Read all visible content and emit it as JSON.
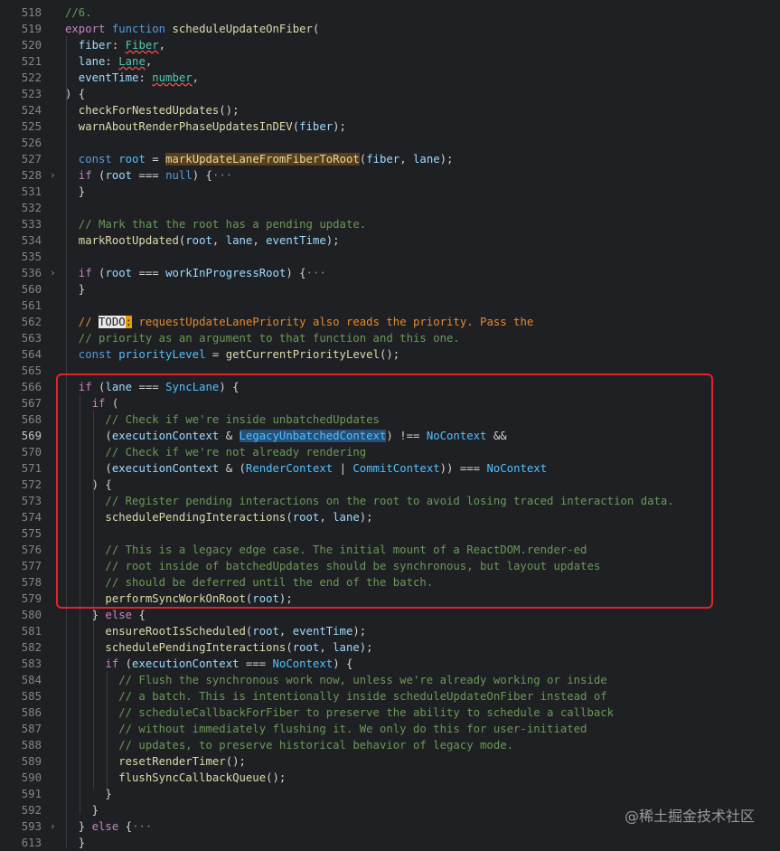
{
  "editor": {
    "lines": [
      {
        "n": "518",
        "segs": [
          [
            "cm",
            "//6."
          ]
        ]
      },
      {
        "n": "519",
        "segs": [
          [
            "ctl",
            "export "
          ],
          [
            "kw",
            "function "
          ],
          [
            "fn",
            "scheduleUpdateOnFiber"
          ],
          [
            "p",
            "("
          ]
        ]
      },
      {
        "n": "520",
        "segs": [
          [
            "var",
            "  fiber"
          ],
          [
            "p",
            ": "
          ],
          [
            "type squig",
            "Fiber"
          ],
          [
            "p",
            ","
          ]
        ]
      },
      {
        "n": "521",
        "segs": [
          [
            "var",
            "  lane"
          ],
          [
            "p",
            ": "
          ],
          [
            "type squig",
            "Lane"
          ],
          [
            "p",
            ","
          ]
        ]
      },
      {
        "n": "522",
        "segs": [
          [
            "var",
            "  eventTime"
          ],
          [
            "p",
            ": "
          ],
          [
            "type squig",
            "number"
          ],
          [
            "p",
            ","
          ]
        ]
      },
      {
        "n": "523",
        "segs": [
          [
            "p",
            ") {"
          ]
        ]
      },
      {
        "n": "524",
        "segs": [
          [
            "fn",
            "  checkForNestedUpdates"
          ],
          [
            "p",
            "();"
          ]
        ]
      },
      {
        "n": "525",
        "segs": [
          [
            "fn",
            "  warnAboutRenderPhaseUpdatesInDEV"
          ],
          [
            "p",
            "("
          ],
          [
            "var",
            "fiber"
          ],
          [
            "p",
            ");"
          ]
        ]
      },
      {
        "n": "526",
        "segs": []
      },
      {
        "n": "527",
        "segs": [
          [
            "kw",
            "  const "
          ],
          [
            "const",
            "root"
          ],
          [
            "p",
            " = "
          ],
          [
            "fn hl-fn",
            "markUpdateLaneFromFiberToRoot"
          ],
          [
            "p",
            "("
          ],
          [
            "var",
            "fiber"
          ],
          [
            "p",
            ", "
          ],
          [
            "var",
            "lane"
          ],
          [
            "p",
            ");"
          ]
        ]
      },
      {
        "n": "528",
        "fold": true,
        "segs": [
          [
            "ctl",
            "  if "
          ],
          [
            "p",
            "("
          ],
          [
            "var",
            "root"
          ],
          [
            "p",
            " === "
          ],
          [
            "kw",
            "null"
          ],
          [
            "p",
            ") {"
          ],
          [
            "ell",
            "···"
          ]
        ]
      },
      {
        "n": "531",
        "segs": [
          [
            "p",
            "  }"
          ]
        ]
      },
      {
        "n": "532",
        "segs": []
      },
      {
        "n": "533",
        "segs": [
          [
            "cm",
            "  // Mark that the root has a pending update."
          ]
        ]
      },
      {
        "n": "534",
        "segs": [
          [
            "fn",
            "  markRootUpdated"
          ],
          [
            "p",
            "("
          ],
          [
            "var",
            "root"
          ],
          [
            "p",
            ", "
          ],
          [
            "var",
            "lane"
          ],
          [
            "p",
            ", "
          ],
          [
            "var",
            "eventTime"
          ],
          [
            "p",
            ");"
          ]
        ]
      },
      {
        "n": "535",
        "segs": []
      },
      {
        "n": "536",
        "fold": true,
        "segs": [
          [
            "ctl",
            "  if "
          ],
          [
            "p",
            "("
          ],
          [
            "var",
            "root"
          ],
          [
            "p",
            " === "
          ],
          [
            "var",
            "workInProgressRoot"
          ],
          [
            "p",
            ") {"
          ],
          [
            "ell",
            "···"
          ]
        ]
      },
      {
        "n": "560",
        "segs": [
          [
            "p",
            "  }"
          ]
        ]
      },
      {
        "n": "561",
        "segs": []
      },
      {
        "n": "562",
        "segs": [
          [
            "cmb",
            "  // "
          ],
          [
            "todo",
            "TODO"
          ],
          [
            "todo-colon",
            ":"
          ],
          [
            "cmb",
            " requestUpdateLanePriority also reads the priority. Pass the"
          ]
        ]
      },
      {
        "n": "563",
        "segs": [
          [
            "cm",
            "  // priority as an argument to that function and this one."
          ]
        ]
      },
      {
        "n": "564",
        "segs": [
          [
            "kw",
            "  const "
          ],
          [
            "const",
            "priorityLevel"
          ],
          [
            "p",
            " = "
          ],
          [
            "fn",
            "getCurrentPriorityLevel"
          ],
          [
            "p",
            "();"
          ]
        ]
      },
      {
        "n": "565",
        "segs": []
      },
      {
        "n": "566",
        "segs": [
          [
            "ctl",
            "  if "
          ],
          [
            "p",
            "("
          ],
          [
            "var",
            "lane"
          ],
          [
            "p",
            " === "
          ],
          [
            "const",
            "SyncLane"
          ],
          [
            "p",
            ") {"
          ]
        ]
      },
      {
        "n": "567",
        "segs": [
          [
            "ctl",
            "    if "
          ],
          [
            "p",
            "("
          ]
        ]
      },
      {
        "n": "568",
        "segs": [
          [
            "cm",
            "      // Check if we're inside unbatchedUpdates"
          ]
        ]
      },
      {
        "n": "569",
        "active": true,
        "segs": [
          [
            "p",
            "      ("
          ],
          [
            "var",
            "executionContext"
          ],
          [
            "p",
            " & "
          ],
          [
            "const hl-sel",
            "LegacyUnbatchedContext"
          ],
          [
            "p",
            ") !== "
          ],
          [
            "const",
            "NoContext"
          ],
          [
            "p",
            " &&"
          ]
        ]
      },
      {
        "n": "570",
        "segs": [
          [
            "cm",
            "      // Check if we're not already rendering"
          ]
        ]
      },
      {
        "n": "571",
        "segs": [
          [
            "p",
            "      ("
          ],
          [
            "var",
            "executionContext"
          ],
          [
            "p",
            " & ("
          ],
          [
            "const",
            "RenderContext"
          ],
          [
            "p",
            " | "
          ],
          [
            "const",
            "CommitContext"
          ],
          [
            "p",
            ")) === "
          ],
          [
            "const",
            "NoContext"
          ]
        ]
      },
      {
        "n": "572",
        "segs": [
          [
            "p",
            "    ) {"
          ]
        ]
      },
      {
        "n": "573",
        "segs": [
          [
            "cm",
            "      // Register pending interactions on the root to avoid losing traced interaction data."
          ]
        ]
      },
      {
        "n": "574",
        "segs": [
          [
            "fn",
            "      schedulePendingInteractions"
          ],
          [
            "p",
            "("
          ],
          [
            "var",
            "root"
          ],
          [
            "p",
            ", "
          ],
          [
            "var",
            "lane"
          ],
          [
            "p",
            ");"
          ]
        ]
      },
      {
        "n": "575",
        "segs": []
      },
      {
        "n": "576",
        "segs": [
          [
            "cm",
            "      // This is a legacy edge case. The initial mount of a ReactDOM.render-ed"
          ]
        ]
      },
      {
        "n": "577",
        "segs": [
          [
            "cm",
            "      // root inside of batchedUpdates should be synchronous, but layout updates"
          ]
        ]
      },
      {
        "n": "578",
        "segs": [
          [
            "cm",
            "      // should be deferred until the end of the batch."
          ]
        ]
      },
      {
        "n": "579",
        "segs": [
          [
            "fn",
            "      performSyncWorkOnRoot"
          ],
          [
            "p",
            "("
          ],
          [
            "var",
            "root"
          ],
          [
            "p",
            ");"
          ]
        ]
      },
      {
        "n": "580",
        "segs": [
          [
            "p",
            "    } "
          ],
          [
            "ctl",
            "else "
          ],
          [
            "p",
            "{"
          ]
        ]
      },
      {
        "n": "581",
        "segs": [
          [
            "fn",
            "      ensureRootIsScheduled"
          ],
          [
            "p",
            "("
          ],
          [
            "var",
            "root"
          ],
          [
            "p",
            ", "
          ],
          [
            "var",
            "eventTime"
          ],
          [
            "p",
            ");"
          ]
        ]
      },
      {
        "n": "582",
        "segs": [
          [
            "fn",
            "      schedulePendingInteractions"
          ],
          [
            "p",
            "("
          ],
          [
            "var",
            "root"
          ],
          [
            "p",
            ", "
          ],
          [
            "var",
            "lane"
          ],
          [
            "p",
            ");"
          ]
        ]
      },
      {
        "n": "583",
        "segs": [
          [
            "ctl",
            "      if "
          ],
          [
            "p",
            "("
          ],
          [
            "var",
            "executionContext"
          ],
          [
            "p",
            " === "
          ],
          [
            "const",
            "NoContext"
          ],
          [
            "p",
            ") {"
          ]
        ]
      },
      {
        "n": "584",
        "segs": [
          [
            "cm",
            "        // Flush the synchronous work now, unless we're already working or inside"
          ]
        ]
      },
      {
        "n": "585",
        "segs": [
          [
            "cm",
            "        // a batch. This is intentionally inside scheduleUpdateOnFiber instead of"
          ]
        ]
      },
      {
        "n": "586",
        "segs": [
          [
            "cm",
            "        // scheduleCallbackForFiber to preserve the ability to schedule a callback"
          ]
        ]
      },
      {
        "n": "587",
        "segs": [
          [
            "cm",
            "        // without immediately flushing it. We only do this for user-initiated"
          ]
        ]
      },
      {
        "n": "588",
        "segs": [
          [
            "cm",
            "        // updates, to preserve historical behavior of legacy mode."
          ]
        ]
      },
      {
        "n": "589",
        "segs": [
          [
            "fn",
            "        resetRenderTimer"
          ],
          [
            "p",
            "();"
          ]
        ]
      },
      {
        "n": "590",
        "segs": [
          [
            "fn",
            "        flushSyncCallbackQueue"
          ],
          [
            "p",
            "();"
          ]
        ]
      },
      {
        "n": "591",
        "segs": [
          [
            "p",
            "      }"
          ]
        ]
      },
      {
        "n": "592",
        "segs": [
          [
            "p",
            "    }"
          ]
        ]
      },
      {
        "n": "593",
        "fold": true,
        "segs": [
          [
            "p",
            "  } "
          ],
          [
            "ctl",
            "else "
          ],
          [
            "p",
            "{"
          ],
          [
            "ell",
            "···"
          ]
        ]
      },
      {
        "n": "613",
        "segs": [
          [
            "p",
            "  }"
          ]
        ]
      }
    ]
  },
  "colors": {
    "background": "#1f2024",
    "annotation_box": "#e3232a"
  },
  "watermark": "@稀土掘金技术社区"
}
